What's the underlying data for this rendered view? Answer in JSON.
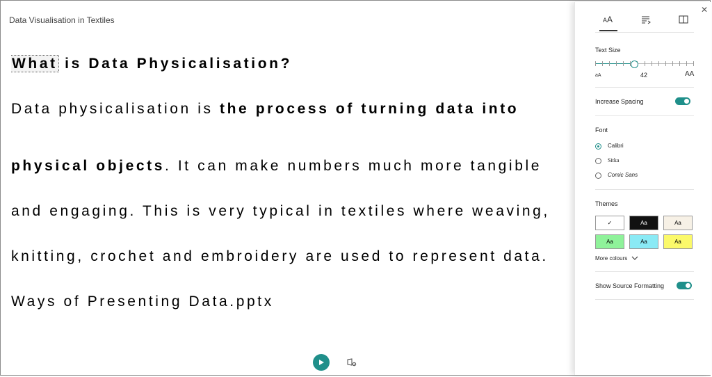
{
  "document": {
    "title": "Data Visualisation in Textiles",
    "heading_highlight": "What",
    "heading_rest": " is Data Physicalisation?",
    "paragraph": {
      "line1_plain": "Data physicalisation is ",
      "line1_bold": "the process of turning data into",
      "line2_bold": "physical objects",
      "line2_plain": ". It can make numbers much more tangible",
      "line3": "and engaging. This is very typical in textiles where weaving,",
      "line4": "knitting, crochet and embroidery are used to represent data."
    },
    "link_text": "Ways of Presenting Data.pptx"
  },
  "controls": {
    "play_icon": "play-icon",
    "voice_icon": "voice-settings-icon"
  },
  "panel": {
    "close_glyph": "✕",
    "tabs": [
      {
        "name": "text-preferences",
        "icon": "text-size-icon",
        "active": true
      },
      {
        "name": "grammar-options",
        "icon": "grammar-icon",
        "active": false
      },
      {
        "name": "reading-preferences",
        "icon": "book-icon",
        "active": false
      }
    ],
    "text_size": {
      "label": "Text Size",
      "value": "42",
      "fraction": 0.4,
      "ticks": 15,
      "small_glyph": "aA",
      "large_glyph": "AA"
    },
    "increase_spacing": {
      "label": "Increase Spacing",
      "on": true
    },
    "font": {
      "label": "Font",
      "options": [
        "Calibri",
        "Sitka",
        "Comic Sans"
      ],
      "selected": "Calibri"
    },
    "themes": {
      "label": "Themes",
      "swatches": [
        {
          "label": "✓",
          "bg": "#ffffff",
          "fg": "#000000",
          "selected": true
        },
        {
          "label": "Aa",
          "bg": "#111111",
          "fg": "#ffffff",
          "selected": false
        },
        {
          "label": "Aa",
          "bg": "#f7f1e6",
          "fg": "#000000",
          "selected": false
        },
        {
          "label": "Aa",
          "bg": "#8ff29a",
          "fg": "#000000",
          "selected": false
        },
        {
          "label": "Aa",
          "bg": "#8aeaf5",
          "fg": "#000000",
          "selected": false
        },
        {
          "label": "Aa",
          "bg": "#fbf96a",
          "fg": "#000000",
          "selected": false
        }
      ],
      "more_label": "More colours"
    },
    "show_source_formatting": {
      "label": "Show Source Formatting",
      "on": true
    }
  },
  "colors": {
    "accent": "#1f8f8a"
  }
}
